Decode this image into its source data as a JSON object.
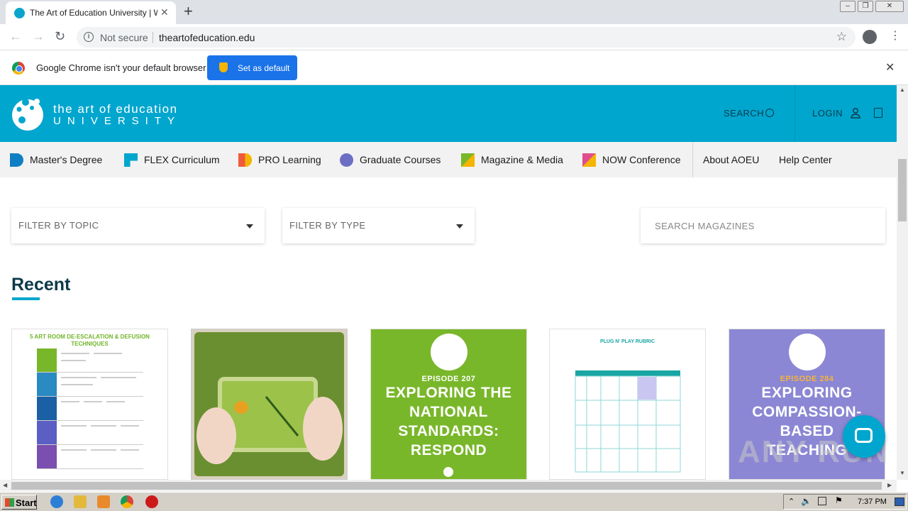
{
  "browser": {
    "tab_title": "The Art of Education University | We",
    "address": {
      "security": "Not secure",
      "url": "theartofeducation.edu"
    },
    "infobar": {
      "message": "Google Chrome isn't your default browser",
      "button": "Set as default"
    }
  },
  "site": {
    "brand": {
      "line1": "the art of education",
      "line2": "UNIVERSITY"
    },
    "header": {
      "search": "SEARCH",
      "login": "LOGIN"
    },
    "nav": [
      {
        "label": "Master's Degree",
        "color": "#0f7fc4"
      },
      {
        "label": "FLEX Curriculum",
        "color": "#00a6ce"
      },
      {
        "label": "PRO Learning",
        "color": "#ef5a3c"
      },
      {
        "label": "Graduate Courses",
        "color": "#6b6fc4"
      },
      {
        "label": "Magazine & Media",
        "color": "#79b72a"
      },
      {
        "label": "NOW Conference",
        "color": "#e04e8f"
      },
      {
        "label": "About AOEU"
      },
      {
        "label": "Help Center"
      }
    ],
    "filters": {
      "topic": "FILTER BY TOPIC",
      "type": "FILTER BY TYPE",
      "search_placeholder": "SEARCH MAGAZINES"
    },
    "section_title": "Recent",
    "cards": [
      {
        "kind": "document",
        "heading": "5 ART ROOM DE-ESCALATION & DEFUSION TECHNIQUES"
      },
      {
        "kind": "photo",
        "heading": ""
      },
      {
        "kind": "episode",
        "episode": "EPISODE 207",
        "title": "EXPLORING THE NATIONAL STANDARDS: RESPOND",
        "color": "#79b72a"
      },
      {
        "kind": "document",
        "heading": "PLUG N' PLAY RUBRIC"
      },
      {
        "kind": "episode",
        "episode": "EPISODE 284",
        "title": "EXPLORING COMPASSION-BASED TEACHING",
        "color": "#8b87d4"
      }
    ]
  },
  "watermark": "ANY RUN",
  "taskbar": {
    "start": "Start",
    "clock": "7:37 PM"
  }
}
